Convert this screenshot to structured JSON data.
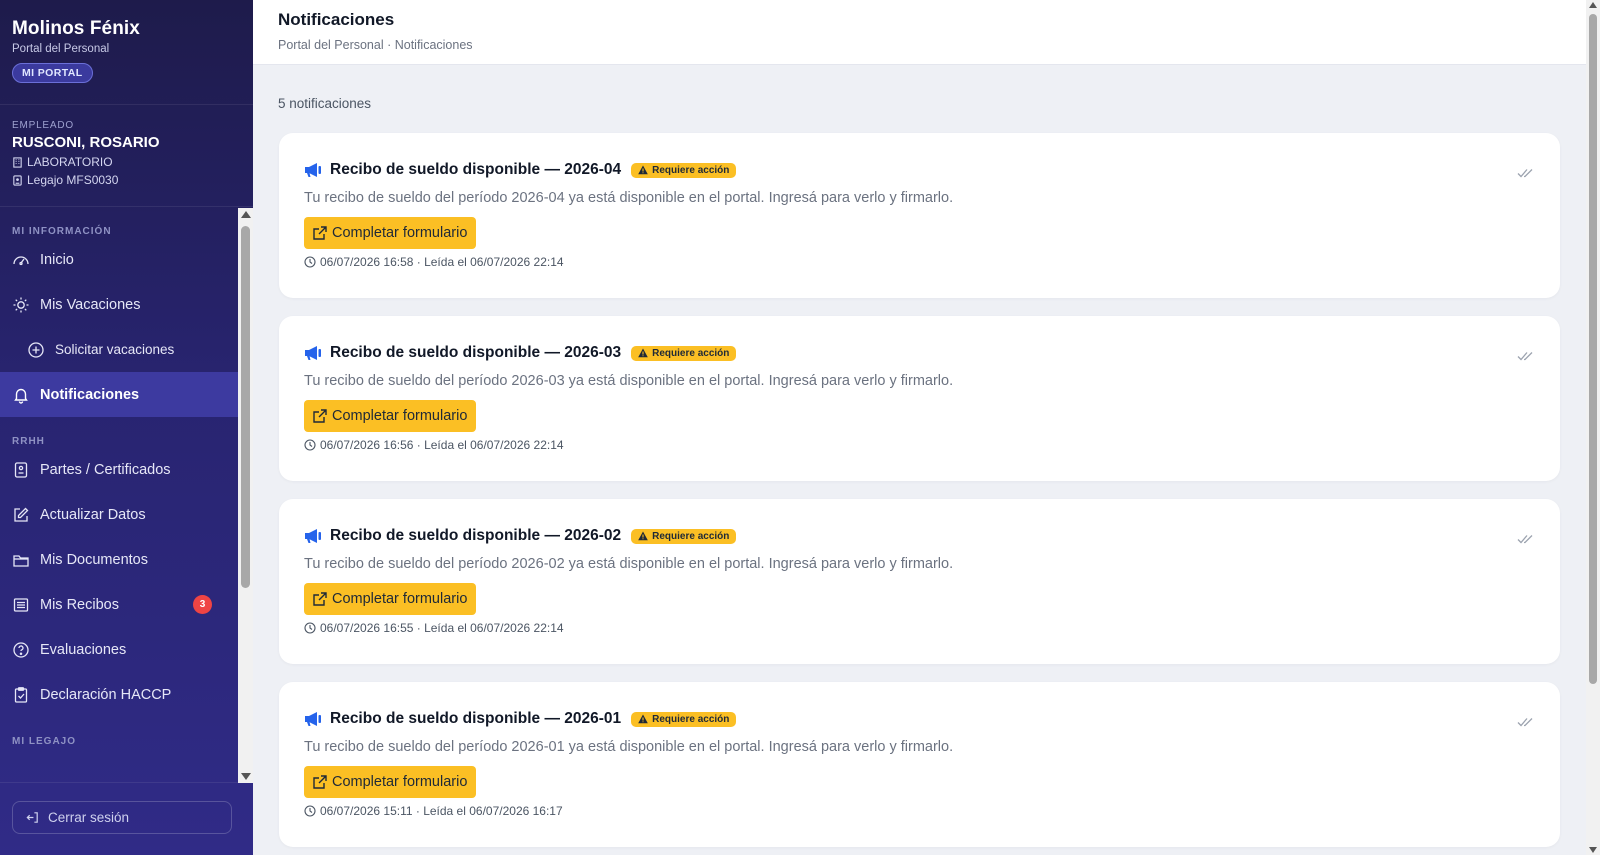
{
  "brand": {
    "title": "Molinos Fénix",
    "subtitle": "Portal del Personal",
    "pill": "MI PORTAL"
  },
  "employee": {
    "label": "EMPLEADO",
    "name": "RUSCONI, ROSARIO",
    "area": "LABORATORIO",
    "legajo": "Legajo MFS0030"
  },
  "nav": {
    "section_info": "MI INFORMACIÓN",
    "inicio": "Inicio",
    "vacaciones": "Mis Vacaciones",
    "solicitar": "Solicitar vacaciones",
    "notificaciones": "Notificaciones",
    "section_rrhh": "RRHH",
    "partes": "Partes / Certificados",
    "actualizar": "Actualizar Datos",
    "documentos": "Mis Documentos",
    "recibos": "Mis Recibos",
    "recibos_badge": "3",
    "evaluaciones": "Evaluaciones",
    "haccp": "Declaración HACCP",
    "section_legajo": "MI LEGAJO"
  },
  "logout": "Cerrar sesión",
  "header": {
    "title": "Notificaciones",
    "breadcrumb": "Portal del Personal · Notificaciones"
  },
  "count_text": "5 notificaciones",
  "notifications": [
    {
      "title": "Recibo de sueldo disponible — 2026-04",
      "badge": "Requiere acción",
      "body": "Tu recibo de sueldo del período 2026-04 ya está disponible en el portal. Ingresá para verlo y firmarlo.",
      "action": "Completar formulario",
      "meta": "06/07/2026 16:58 · Leída el 06/07/2026 22:14"
    },
    {
      "title": "Recibo de sueldo disponible — 2026-03",
      "badge": "Requiere acción",
      "body": "Tu recibo de sueldo del período 2026-03 ya está disponible en el portal. Ingresá para verlo y firmarlo.",
      "action": "Completar formulario",
      "meta": "06/07/2026 16:56 · Leída el 06/07/2026 22:14"
    },
    {
      "title": "Recibo de sueldo disponible — 2026-02",
      "badge": "Requiere acción",
      "body": "Tu recibo de sueldo del período 2026-02 ya está disponible en el portal. Ingresá para verlo y firmarlo.",
      "action": "Completar formulario",
      "meta": "06/07/2026 16:55 · Leída el 06/07/2026 22:14"
    },
    {
      "title": "Recibo de sueldo disponible — 2026-01",
      "badge": "Requiere acción",
      "body": "Tu recibo de sueldo del período 2026-01 ya está disponible en el portal. Ingresá para verlo y firmarlo.",
      "action": "Completar formulario",
      "meta": "06/07/2026 15:11 · Leída el 06/07/2026 16:17"
    }
  ],
  "colors": {
    "sidebar_top": "#1e1b4b",
    "sidebar_active": "#3d3aa0",
    "accent_yellow": "#fbbf24",
    "badge_red": "#ef4444",
    "megaphone_blue": "#2563eb"
  }
}
